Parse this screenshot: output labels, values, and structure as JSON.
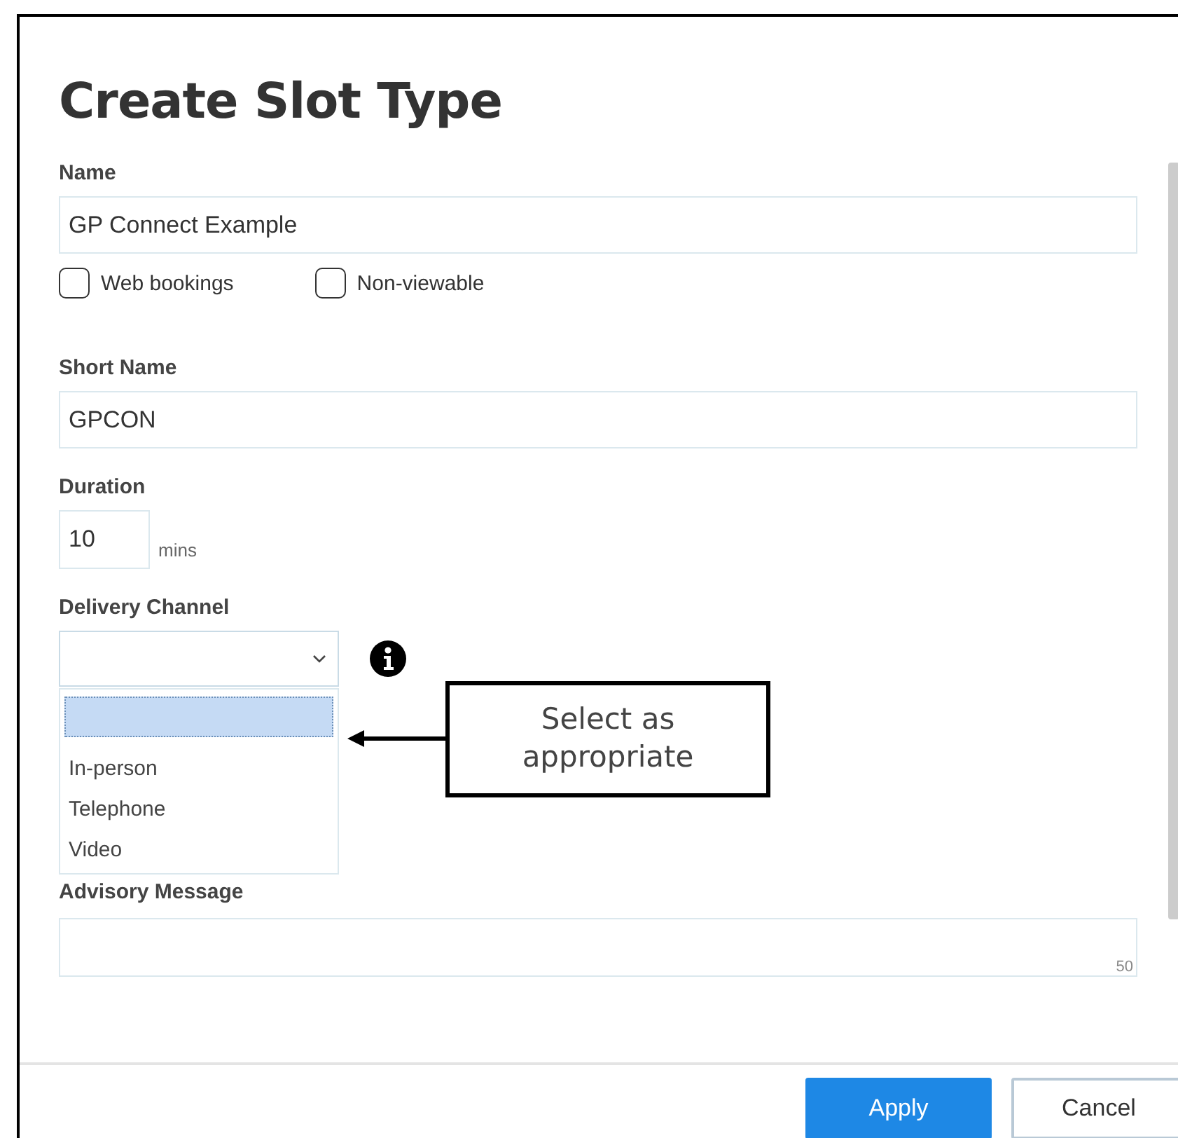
{
  "dialog": {
    "title": "Create Slot Type"
  },
  "name_field": {
    "label": "Name",
    "value": "GP Connect Example"
  },
  "checkboxes": [
    {
      "label": "Web bookings",
      "checked": false
    },
    {
      "label": "Non-viewable",
      "checked": false
    }
  ],
  "short_name_field": {
    "label": "Short Name",
    "value": "GPCON"
  },
  "duration_field": {
    "label": "Duration",
    "value": "10",
    "unit": "mins"
  },
  "delivery_channel": {
    "label": "Delivery Channel",
    "expanded": true,
    "options": [
      {
        "selected": true
      },
      {
        "label": "In-person",
        "selected": false
      },
      {
        "label": "Telephone",
        "selected": false
      },
      {
        "label": "Video",
        "selected": false
      }
    ]
  },
  "callout": {
    "text": "Select as appropriate"
  },
  "advisory_message": {
    "label": "Advisory Message",
    "counter": "50"
  },
  "buttons": [
    {
      "label": "Apply",
      "kind": "primary"
    },
    {
      "label": "Cancel",
      "kind": "secondary"
    }
  ]
}
